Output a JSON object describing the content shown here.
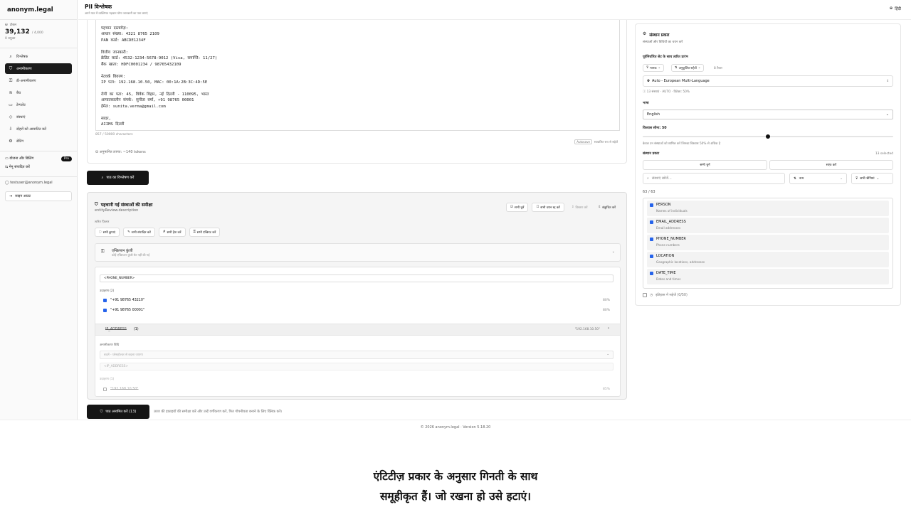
{
  "app": {
    "brand": "anonym.legal"
  },
  "tokens": {
    "label": "टोकन",
    "value": "39,132",
    "max": "/ 4,000",
    "sub": "0 प्रयुक्त"
  },
  "nav": {
    "items": [
      {
        "label": "विश्लेषक",
        "icon": "search-icon"
      },
      {
        "label": "अनामीकरण",
        "icon": "shield-icon",
        "active": true
      },
      {
        "label": "डी-अनामीकरण",
        "icon": "unlock-icon"
      },
      {
        "label": "बैच",
        "icon": "layers-icon"
      },
      {
        "label": "टेम्पलेट",
        "icon": "file-icon"
      },
      {
        "label": "संस्थाएं",
        "icon": "tag-icon"
      },
      {
        "label": "दोहरों को आयातित करें",
        "icon": "import-icon"
      },
      {
        "label": "सेटिंग",
        "icon": "gear-icon"
      }
    ]
  },
  "plan": {
    "label": "योजना और बिलिंग",
    "badge": "Pro",
    "menu": "मेनू संपादित करें"
  },
  "user": {
    "email": "testuser@anonym.legal",
    "logout": "साइन आउट"
  },
  "header": {
    "title": "PII विश्लेषक",
    "subtitle": "अपने पाठ में व्यक्तिगत पहचान योग्य जानकारी का पता लगाएं",
    "language": "हिंदी"
  },
  "editor": {
    "text": "पहचान दस्तावेज़:\nआधार संख्या: 4321 8765 2109\nPAN कार्ड: ABCDE1234F\n\nवित्तीय जानकारी:\nक्रेडिट कार्ड: 4532-1234-5678-9012 (Visa, समाप्ति: 11/27)\nबैंक खाता: HDFC0001234 / 98765432109\n\nनेटवर्क विवरण:\nIP पता: 192.168.10.50, MAC: 00:1A:2B:3C:4D:5E\n\nरोगी का पता: 45, विवेक विहार, नई दिल्ली - 110095, भारत\nआपातकालीन संपर्क: सुनीता वर्मा, +91 98765 00001\nईमेल: sunita.verma@gmail.com\n\nसादर,\nAIIMS दिल्ली",
    "charcount": "857 / 50000 characters",
    "autosave_key": "Autosave",
    "autosave_text": "स्वचालित रूप से सहेजें",
    "token_estimate": "अनुमानित लागत: ~140 tokens"
  },
  "analyze_button": "पाठ का विश्लेषण करें",
  "review": {
    "title": "पहचानी गई संस्थाओं की समीक्षा",
    "description": "entityReview.description",
    "actions": [
      "सभी चुनें",
      "सभी चयन रद्द करें",
      "विस्तार करें",
      "संकुचित करें"
    ],
    "quick_filter": "त्वरित फ़िल्टर",
    "chips": [
      "सभी छुपाएं",
      "सभी संपादित करें",
      "सभी हैश करें",
      "सभी एन्क्रिप्ट करें"
    ],
    "group": {
      "title": "एन्क्रिप्शन कुंजी",
      "desc": "कोई एन्क्रिप्शन कुंजी सेट नहीं की गई"
    },
    "detail": {
      "placeholder": "<PHONE_NUMBER>",
      "occ_label": "उदाहरण (2)",
      "occurrences": [
        {
          "text": "\"+91 98765 43210\"",
          "conf": "80%"
        },
        {
          "text": "\"+91 98765 00001\"",
          "conf": "80%"
        }
      ],
      "group2_type": "IP_ADDRESS",
      "group2_count": "(1)",
      "group2_value": "\"192.168.10.50\"",
      "method_label": "अनामीकरण विधि",
      "method_value": "बदलें - प्लेसहोल्डर से बदला जाएगा",
      "placeholder2": "<IP_ADDRESS>",
      "occ2_label": "उदाहरण (1)",
      "occ2_text": "\"192.168.10.50\"",
      "occ2_conf": "85%"
    }
  },
  "anon_button": "पाठ अनामित करें (13)",
  "anon_hint": "ऊपर की इकाइयों की समीक्षा करें और उन्हें वर्गीकरण करें, फिर गोपनीयता बनाने के लिए क्लिक करें।",
  "footer": "© 2026 anonym.legal · Version 5.18.20",
  "right": {
    "title": "संस्थान प्रकार",
    "desc": "संस्थाओं और विधियों का चयन करें",
    "preset_label": "पूर्वनिर्धारित सेट के साथ त्वरित प्रारंभ",
    "btn_default": "मानक",
    "btn_save": "अनुकूलित सहेजें",
    "saved_count": "8 तैयार",
    "preset_value": "Auto - European Multi-Language",
    "preset_info": "13 संस्थाएं · AUTO · डिटेक्ट: 50%",
    "lang_label": "भाषा",
    "lang_value": "English",
    "threshold_label": "विश्वास सीमा: 50",
    "threshold_value": 0.5,
    "threshold_hint": "केवल उन संस्थाओं को शामिल करें जिनका विश्वास 50% से अधिक है",
    "types_label": "संस्थान प्रकार",
    "types_selected": "13 selected",
    "select_all": "सभी चुनें",
    "clear": "साफ़ करें",
    "search_placeholder": "संस्थाएं खोजें...",
    "sort_value": "नाम",
    "category_value": "सभी श्रेणियां",
    "count": "63 / 63",
    "entities": [
      {
        "name": "PERSON",
        "desc": "Names of individuals"
      },
      {
        "name": "EMAIL_ADDRESS",
        "desc": "Email addresses"
      },
      {
        "name": "PHONE_NUMBER",
        "desc": "Phone numbers"
      },
      {
        "name": "LOCATION",
        "desc": "Geographic locations, addresses"
      },
      {
        "name": "DATE_TIME",
        "desc": "Dates and times"
      }
    ],
    "history": "इतिहास में सहेजें (0/50)"
  },
  "caption": {
    "line1": "एंटिटीज़ प्रकार के अनुसार गिनती के साथ",
    "line2": "समूहीकृत हैं। जो रखना हो उसे हटाएं।"
  }
}
